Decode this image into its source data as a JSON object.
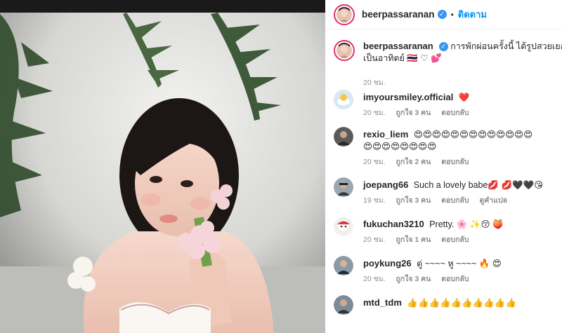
{
  "photo": {
    "alt_hidden": ""
  },
  "header": {
    "username": "beerpassaranan",
    "verified_mark": "✓",
    "dot": "•",
    "follow": "ติดตาม"
  },
  "caption": {
    "username": "beerpassaranan",
    "verified_mark": "✓",
    "text_line1": "การพักผ่อนครั้งนี้ ได้รูปสวยเยอะมาก",
    "text_line2": "เป็นอาทิตย์ 🇹🇭 ♡ 💕",
    "time": "20 ชม."
  },
  "comments": [
    {
      "username": "imyoursmiley.official",
      "text": "❤️",
      "time": "20 ชม.",
      "likes": "ถูกใจ 3 คน",
      "reply": "ตอบกลับ",
      "extra": ""
    },
    {
      "username": "rexio_liem",
      "text": "😍😍😍😍😍😍😍😍😍😍😍😍😍",
      "text2": "😍😍😍😍😍😍😍😍",
      "time": "20 ชม.",
      "likes": "ถูกใจ 2 คน",
      "reply": "ตอบกลับ",
      "extra": ""
    },
    {
      "username": "joepang66",
      "text": "Such a lovely babe💋 💋🖤🖤😘",
      "time": "19 ชม.",
      "likes": "ถูกใจ 3 คน",
      "reply": "ตอบกลับ",
      "extra": "ดูคำแปล"
    },
    {
      "username": "fukuchan3210",
      "text": "Pretty. 🌸 ✨😚 🍑",
      "time": "20 ชม.",
      "likes": "ถูกใจ 1 คน",
      "reply": "ตอบกลับ",
      "extra": ""
    },
    {
      "username": "poykung26",
      "text": "ตู่ ~~~~ หู ~~~~ 🔥 😍",
      "time": "20 ชม.",
      "likes": "ถูกใจ 3 คน",
      "reply": "ตอบกลับ",
      "extra": ""
    },
    {
      "username": "mtd_tdm",
      "text": "👍👍👍👍👍👍👍👍👍👍",
      "time": "",
      "likes": "",
      "reply": "",
      "extra": ""
    }
  ]
}
